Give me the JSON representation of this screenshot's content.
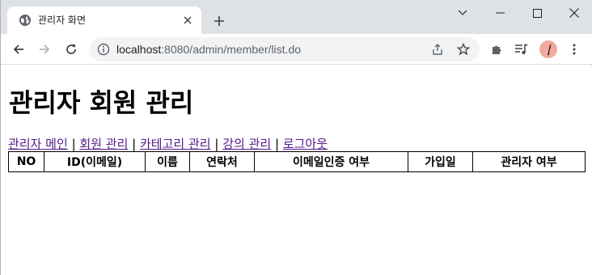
{
  "browser": {
    "tab_title": "관리자 화면",
    "url_host": "localhost",
    "url_rest": ":8080/admin/member/list.do"
  },
  "page": {
    "title": "관리자 회원 관리",
    "nav": [
      {
        "label": "관리자 메인"
      },
      {
        "label": "회원 관리"
      },
      {
        "label": "카테고리 관리"
      },
      {
        "label": "강의 관리"
      },
      {
        "label": "로그아웃"
      }
    ],
    "separator": "|",
    "table": {
      "columns": [
        "NO",
        "ID(이메일)",
        "이름",
        "연락처",
        "이메일인증 여부",
        "가입일",
        "관리자 여부"
      ]
    }
  },
  "colors": {
    "link": "#1a0dab",
    "visited_link": "#551a8b",
    "titlebar": "#dee1e6"
  }
}
